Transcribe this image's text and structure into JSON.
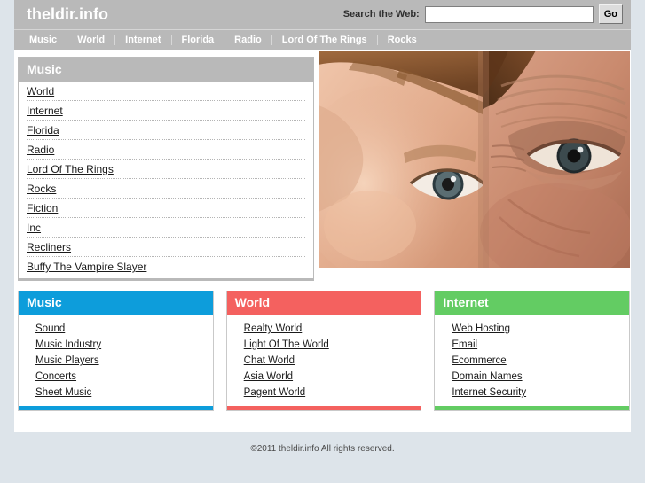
{
  "header": {
    "logo": "theldir.info",
    "search_label": "Search the Web:",
    "search_value": "",
    "search_placeholder": "",
    "go_label": "Go"
  },
  "nav": {
    "items": [
      {
        "label": "Music"
      },
      {
        "label": "World"
      },
      {
        "label": "Internet"
      },
      {
        "label": "Florida"
      },
      {
        "label": "Radio"
      },
      {
        "label": "Lord Of The Rings"
      },
      {
        "label": "Rocks"
      }
    ]
  },
  "main": {
    "category_panel": {
      "title": "Music",
      "links": [
        "World",
        "Internet",
        "Florida",
        "Radio",
        "Lord Of The Rings",
        "Rocks",
        "Fiction",
        "Inc",
        "Recliners",
        "Buffy The Vampire Slayer"
      ]
    },
    "hero_image": {
      "alt": "close-up photo of a child's face beside an elderly person's face"
    }
  },
  "panels": [
    {
      "title": "Music",
      "color": "#0d9ddb",
      "links": [
        "Sound",
        "Music Industry",
        "Music Players",
        "Concerts",
        "Sheet Music"
      ]
    },
    {
      "title": "World",
      "color": "#f4615f",
      "links": [
        "Realty World",
        "Light Of The World",
        "Chat World",
        "Asia World",
        "Pagent World"
      ]
    },
    {
      "title": "Internet",
      "color": "#63cc63",
      "links": [
        "Web Hosting",
        "Email",
        "Ecommerce",
        "Domain Names",
        "Internet Security"
      ]
    }
  ],
  "footer": {
    "copyright": "©2011 theldir.info All rights reserved."
  },
  "colors": {
    "page_background": "#dde4ea",
    "header_gray": "#b9b9b9",
    "panel_blue": "#0d9ddb",
    "panel_red": "#f4615f",
    "panel_green": "#63cc63"
  }
}
